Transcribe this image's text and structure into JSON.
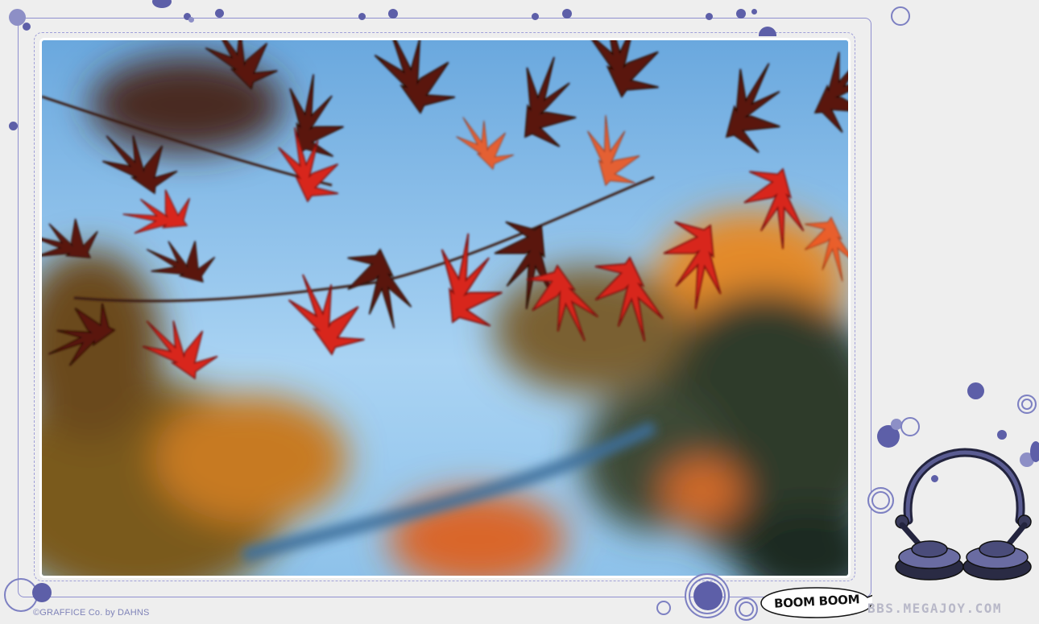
{
  "photo": {
    "subject": "red maple leaves against a blurred blue sky"
  },
  "copyright": "©GRAFFICE Co. by DAHNS",
  "speech_bubble": {
    "text": "BOOM BOOM"
  },
  "site": {
    "text": "BBS.MEGAJOY.COM"
  },
  "colors": {
    "frame": "#8f8fcf",
    "dot": "#5d5fa8",
    "background": "#eeeeee",
    "leaf_red": "#d8261a",
    "sky": "#7fb7e6"
  },
  "icons": [
    "headphones-icon"
  ]
}
